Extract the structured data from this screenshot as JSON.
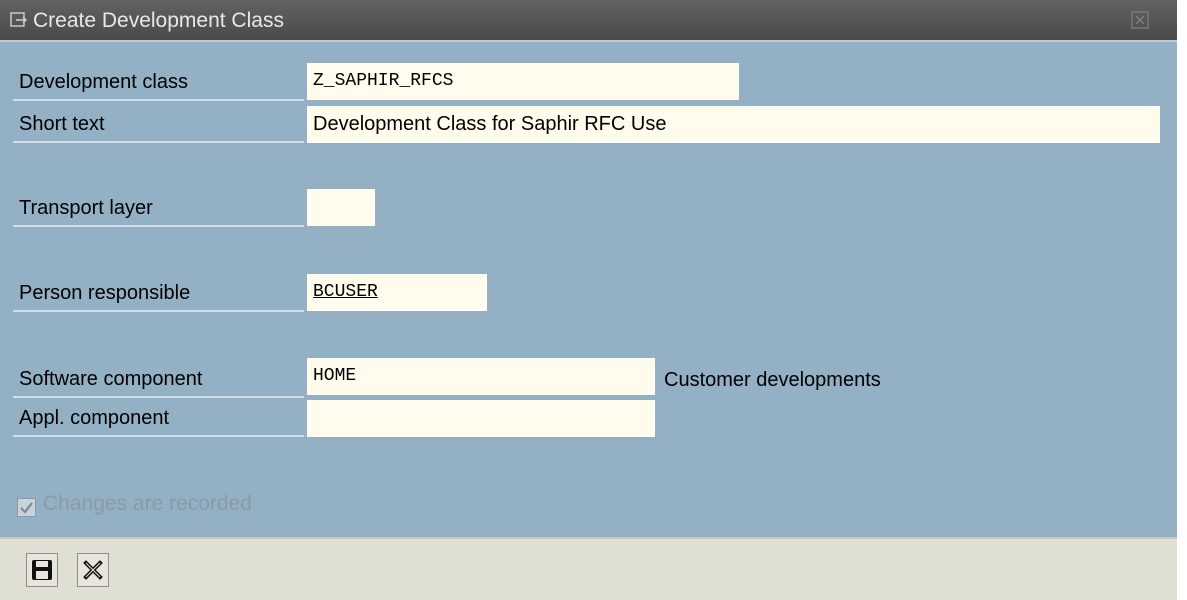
{
  "window": {
    "title": "Create Development Class"
  },
  "form": {
    "development_class": {
      "label": "Development class",
      "value": "Z_SAPHIR_RFCS"
    },
    "short_text": {
      "label": "Short text",
      "value": "Development Class for Saphir RFC Use"
    },
    "transport_layer": {
      "label": "Transport layer",
      "value": ""
    },
    "person_responsible": {
      "label": "Person responsible",
      "value": "BCUSER"
    },
    "software_component": {
      "label": "Software component",
      "value": "HOME",
      "description": "Customer developments"
    },
    "appl_component": {
      "label": "Appl. component",
      "value": ""
    }
  },
  "options": {
    "changes_recorded": {
      "label": "Changes are recorded",
      "checked": true,
      "enabled": false
    }
  },
  "toolbar": {
    "buttons": [
      {
        "icon": "save-icon"
      },
      {
        "icon": "cancel-icon"
      }
    ]
  },
  "colors": {
    "background": "#94b0c4",
    "field": "#fffced",
    "titlebar": "#5c5c5c"
  }
}
